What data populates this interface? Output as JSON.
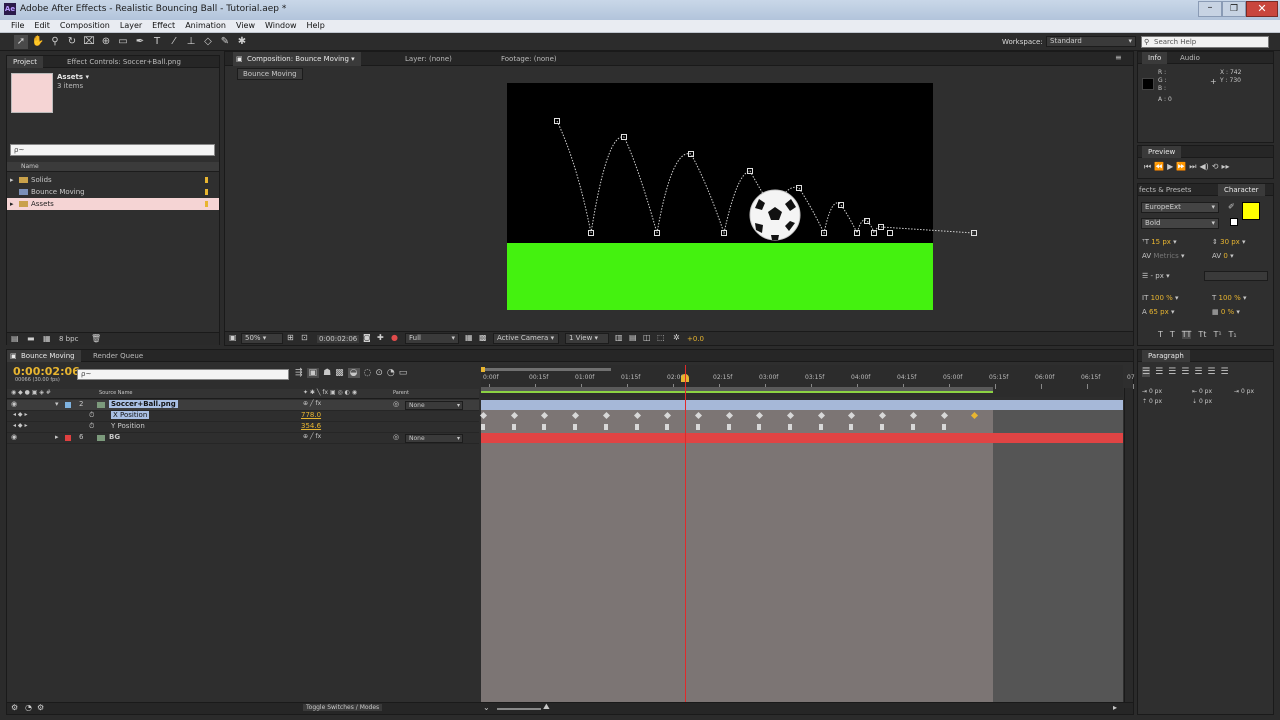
{
  "window": {
    "title": "Adobe After Effects - Realistic Bouncing Ball - Tutorial.aep *",
    "app_icon": "Ae"
  },
  "menu": [
    "File",
    "Edit",
    "Composition",
    "Layer",
    "Effect",
    "Animation",
    "View",
    "Window",
    "Help"
  ],
  "toolbar": {
    "workspace_label": "Workspace:",
    "workspace_value": "Standard",
    "search_placeholder": "Search Help"
  },
  "project_panel": {
    "tab_project": "Project",
    "tab_effect_controls": "Effect Controls: Soccer+Ball.png",
    "asset_name": "Assets ▾",
    "asset_count": "3 items",
    "search_placeholder": "ρ~",
    "column_name": "Name",
    "items": [
      {
        "label": "Solids",
        "type": "folder"
      },
      {
        "label": "Bounce Moving",
        "type": "comp"
      },
      {
        "label": "Assets",
        "type": "folder",
        "selected": true
      }
    ],
    "bpc": "8 bpc"
  },
  "comp_panel": {
    "tab_comp": "Composition: Bounce Moving",
    "tab_layer": "Layer: (none)",
    "tab_footage": "Footage: (none)",
    "subtab": "Bounce Moving",
    "zoom": "50%",
    "timecode": "0:00:02:06",
    "resolution": "Full",
    "camera": "Active Camera",
    "view": "1 View",
    "exposure": "+0.0",
    "colors": {
      "sky": "#000000",
      "ground": "#44f20f",
      "path": "#d0d0d0"
    }
  },
  "info_panel": {
    "tab_info": "Info",
    "tab_audio": "Audio",
    "r": "R :",
    "g": "G :",
    "b": "B :",
    "a": "A : 0",
    "x": "X : 742",
    "y": "Y : 730"
  },
  "preview_panel": {
    "tab": "Preview"
  },
  "character_panel": {
    "tab_effects": "fects & Presets",
    "tab_character": "Character",
    "font": "EuropeExt",
    "style": "Bold",
    "size": "15 px",
    "leading": "30 px",
    "kerning": "Metrics",
    "tracking": "0",
    "stroke": "- px",
    "vscale": "100 %",
    "hscale": "100 %",
    "baseline": "65 px",
    "tsume": "0 %",
    "fill_color": "#ffff00"
  },
  "paragraph_panel": {
    "tab": "Paragraph",
    "indent1": "0 px",
    "indent2": "0 px",
    "indent3": "0 px",
    "indent4": "0 px",
    "indent5": "0 px"
  },
  "timeline": {
    "tab_comp": "Bounce Moving",
    "tab_render": "Render Queue",
    "timecode": "0:00:02:06",
    "frame_info": "00066 (30.00 fps)",
    "search_placeholder": "ρ~",
    "col_source": "Source Name",
    "col_parent": "Parent",
    "ruler": [
      "0:00f",
      "00:15f",
      "01:00f",
      "01:15f",
      "02:00f",
      "02:15f",
      "03:00f",
      "03:15f",
      "04:00f",
      "04:15f",
      "05:00f",
      "05:15f",
      "06:00f",
      "06:15f",
      "07"
    ],
    "layers": [
      {
        "num": "2",
        "name": "Soccer+Ball.png",
        "parent": "None",
        "color": "#7fb3e0"
      },
      {
        "name": "X Position",
        "value": "778.0"
      },
      {
        "name": "Y Position",
        "value": "354.6"
      },
      {
        "num": "6",
        "name": "BG",
        "parent": "None",
        "color": "#e04040"
      }
    ],
    "toggle_label": "Toggle Switches / Modes"
  }
}
